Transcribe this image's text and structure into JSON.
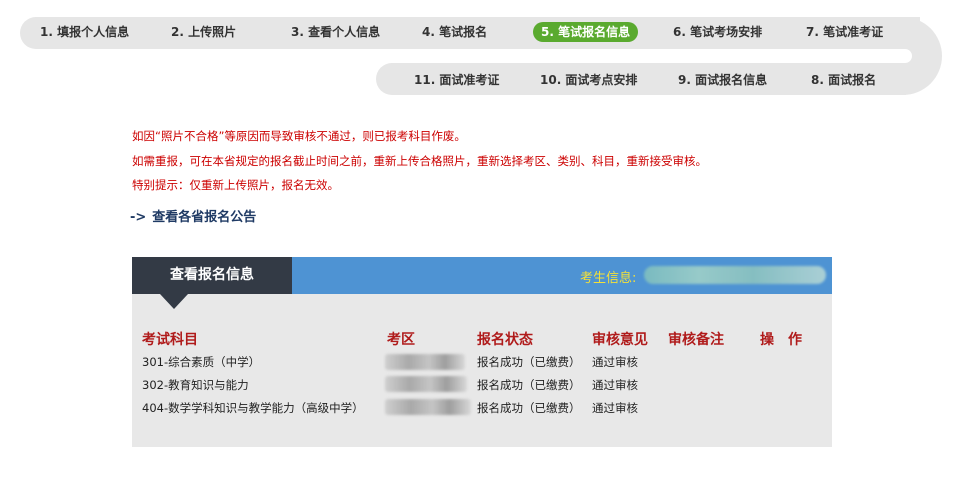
{
  "steps_top": [
    {
      "label": "1. 填报个人信息",
      "active": false
    },
    {
      "label": "2. 上传照片",
      "active": false
    },
    {
      "label": "3. 查看个人信息",
      "active": false
    },
    {
      "label": "4. 笔试报名",
      "active": false
    },
    {
      "label": "5. 笔试报名信息",
      "active": true
    },
    {
      "label": "6. 笔试考场安排",
      "active": false
    },
    {
      "label": "7. 笔试准考证",
      "active": false
    }
  ],
  "steps_bottom": [
    {
      "label": "11. 面试准考证",
      "active": false
    },
    {
      "label": "10. 面试考点安排",
      "active": false
    },
    {
      "label": "9. 面试报名信息",
      "active": false
    },
    {
      "label": "8. 面试报名",
      "active": false
    }
  ],
  "notices": [
    "如因“照片不合格”等原因而导致审核不通过，则已报考科目作废。",
    "如需重报，可在本省规定的报名截止时间之前，重新上传合格照片，重新选择考区、类别、科目，重新接受审核。",
    "特别提示：仅重新上传照片，报名无效。"
  ],
  "announcement_link": {
    "arrow": "->",
    "label": "查看各省报名公告"
  },
  "panel": {
    "tab_label": "查看报名信息",
    "examinee_label": "考生信息:",
    "columns": [
      "考试科目",
      "考区",
      "报名状态",
      "审核意见",
      "审核备注",
      "操　作"
    ],
    "rows": [
      {
        "subject": "301-综合素质（中学）",
        "status": "报名成功（已缴费）",
        "review": "通过审核",
        "note": "",
        "action": ""
      },
      {
        "subject": "302-教育知识与能力",
        "status": "报名成功（已缴费）",
        "review": "通过审核",
        "note": "",
        "action": ""
      },
      {
        "subject": "404-数学学科知识与教学能力（高级中学）",
        "status": "报名成功（已缴费）",
        "review": "通过审核",
        "note": "",
        "action": ""
      }
    ]
  },
  "colors": {
    "track": "#e6e6e6",
    "active_step": "#5aaa2f",
    "notice_text": "#cc0000",
    "link_text": "#1f3a64",
    "panel_header_blue": "#4e93d3",
    "panel_tab_dark": "#333a45",
    "examinee_label": "#f3e03a",
    "column_header": "#b01b1b",
    "panel_body": "#e8e8e8"
  }
}
